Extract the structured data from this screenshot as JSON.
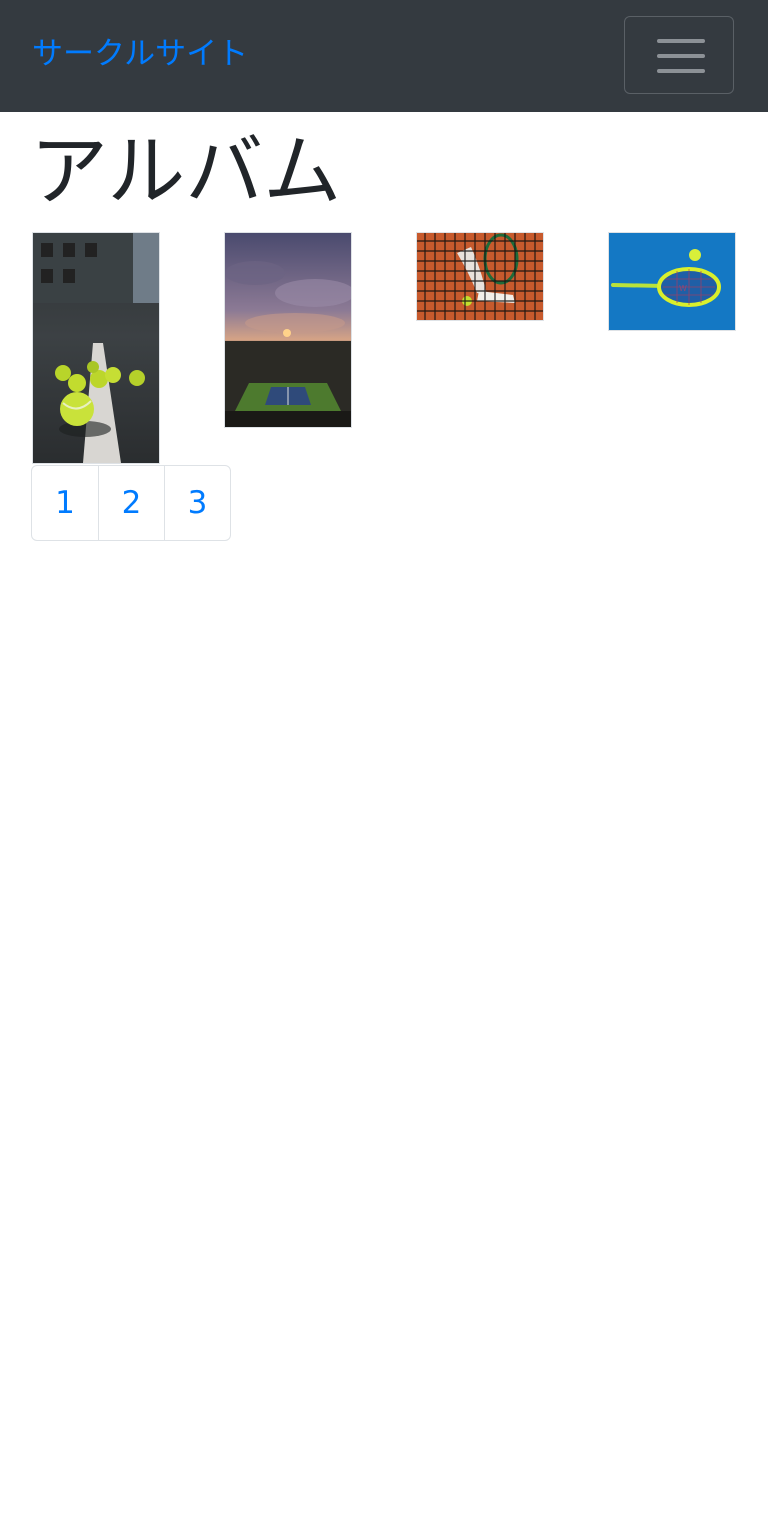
{
  "navbar": {
    "brand": "サークルサイト",
    "toggler_icon": "menu-icon"
  },
  "page": {
    "title": "アルバム"
  },
  "album": {
    "photos": [
      {
        "subject": "tennis balls on court line"
      },
      {
        "subject": "tennis stadium at sunset"
      },
      {
        "subject": "tennis net with player on clay court"
      },
      {
        "subject": "tennis racket and ball on blue court"
      }
    ]
  },
  "pagination": {
    "pages": [
      "1",
      "2",
      "3"
    ]
  },
  "colors": {
    "navbar_bg": "#343a40",
    "link": "#007bff",
    "text": "#212529",
    "border": "#dee2e6"
  }
}
